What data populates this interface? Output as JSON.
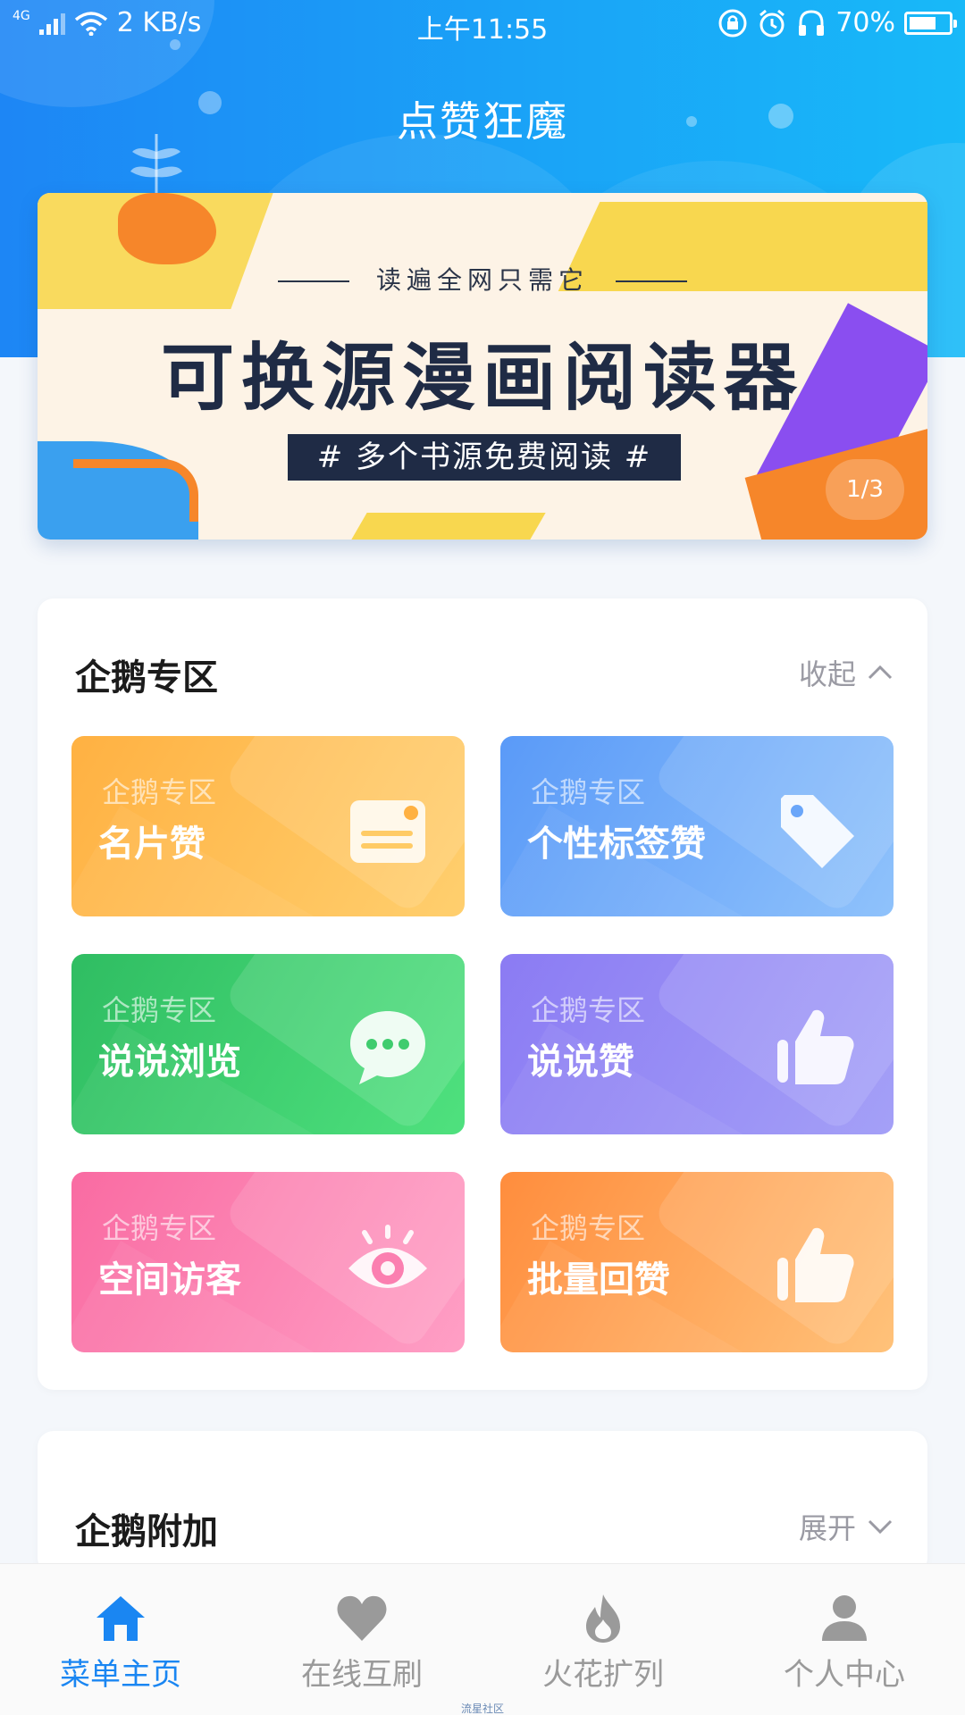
{
  "status_bar": {
    "network": "4G",
    "speed": "2 KB/s",
    "time": "上午11:55",
    "battery": "70%",
    "icons": [
      "signal-icon",
      "wifi-icon",
      "lock-rotate-icon",
      "alarm-icon",
      "headphones-icon",
      "battery-icon"
    ]
  },
  "header": {
    "title": "点赞狂魔"
  },
  "banner": {
    "subtitle": "读遍全网只需它",
    "title": "可换源漫画阅读器",
    "tag": "# 多个书源免费阅读 #",
    "indicator": "1/3"
  },
  "section_zone": {
    "title": "企鹅专区",
    "toggle_label": "收起",
    "tiles": [
      {
        "kicker": "企鹅专区",
        "label": "名片赞",
        "icon": "card-icon",
        "color": "#ffb142"
      },
      {
        "kicker": "企鹅专区",
        "label": "个性标签赞",
        "icon": "tag-icon",
        "color": "#5a9af8"
      },
      {
        "kicker": "企鹅专区",
        "label": "说说浏览",
        "icon": "chat-bubble-icon",
        "color": "#2fbd62"
      },
      {
        "kicker": "企鹅专区",
        "label": "说说赞",
        "icon": "thumbs-up-icon",
        "color": "#8b7bf3"
      },
      {
        "kicker": "企鹅专区",
        "label": "空间访客",
        "icon": "eye-icon",
        "color": "#f96ba2"
      },
      {
        "kicker": "企鹅专区",
        "label": "批量回赞",
        "icon": "thumbs-up-icon",
        "color": "#ff8d3d"
      }
    ]
  },
  "section_extra": {
    "title": "企鹅附加",
    "toggle_label": "展开"
  },
  "bottom_nav": {
    "items": [
      {
        "label": "菜单主页",
        "icon": "home-icon",
        "active": true
      },
      {
        "label": "在线互刷",
        "icon": "heart-icon",
        "active": false
      },
      {
        "label": "火花扩列",
        "icon": "flame-icon",
        "active": false
      },
      {
        "label": "个人中心",
        "icon": "person-icon",
        "active": false
      }
    ]
  },
  "watermark": "流星社区",
  "colors": {
    "accent": "#1a86f2",
    "header": "#1d86f5",
    "inactive": "#9a9a9a"
  }
}
